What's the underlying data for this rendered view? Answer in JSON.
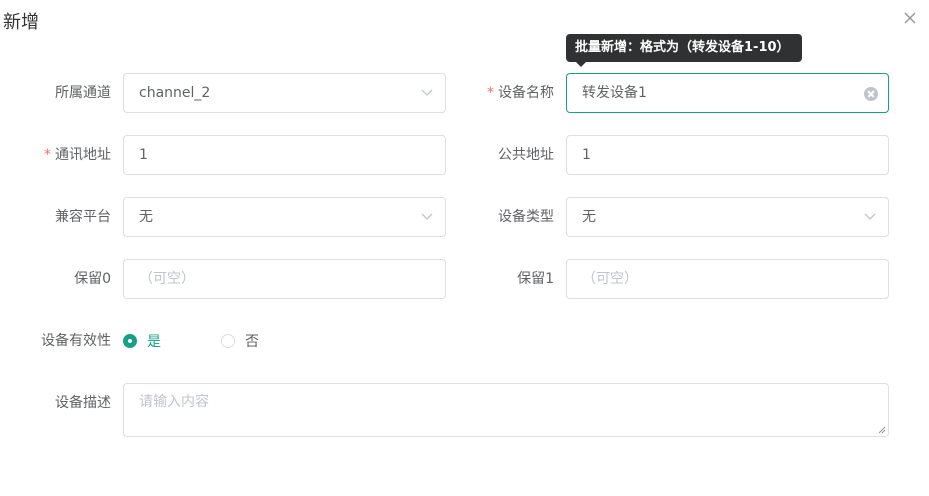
{
  "dialog": {
    "title": "新增"
  },
  "tooltip": {
    "text": "批量新增：格式为（转发设备1-10）"
  },
  "fields": {
    "channel": {
      "label": "所属通道",
      "value": "channel_2"
    },
    "device_name": {
      "label": "设备名称",
      "value": "转发设备1"
    },
    "comm_addr": {
      "label": "通讯地址",
      "value": "1"
    },
    "public_addr": {
      "label": "公共地址",
      "value": "1"
    },
    "platform": {
      "label": "兼容平台",
      "value": "无"
    },
    "device_type": {
      "label": "设备类型",
      "value": "无"
    },
    "reserve0": {
      "label": "保留0",
      "placeholder": "（可空）"
    },
    "reserve1": {
      "label": "保留1",
      "placeholder": "（可空）"
    },
    "valid": {
      "label": "设备有效性",
      "options": [
        "是",
        "否"
      ],
      "selected": "是"
    },
    "description": {
      "label": "设备描述",
      "placeholder": "请输入内容"
    }
  },
  "required_mark": "*",
  "colors": {
    "accent": "#16a085",
    "required": "#f56c6c",
    "tooltip_bg": "#303133"
  }
}
